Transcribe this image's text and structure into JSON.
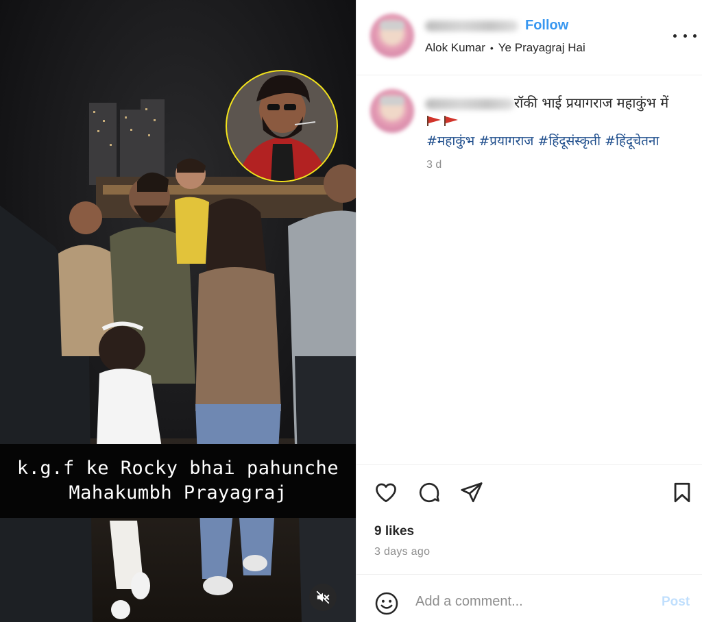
{
  "media": {
    "caption_lines": [
      "k.g.f ke Rocky bhai pahunche",
      "Mahakumbh Prayagraj"
    ],
    "mute_icon": "speaker-muted-icon"
  },
  "header": {
    "follow_label": "Follow",
    "audio_artist": "Alok Kumar",
    "audio_separator": "•",
    "audio_title": "Ye Prayagraj Hai",
    "more_icon": "more-horizontal-icon"
  },
  "caption": {
    "text": "रॉकी भाई प्रयागराज महाकुंभ में",
    "flags_icon": "red-flag-icon",
    "hashtags": [
      "#महाकुंभ",
      "#प्रयागराज",
      "#हिंदूसंस्कृती",
      "#हिंदूचेतना"
    ],
    "age": "3 d"
  },
  "actions": {
    "like_icon": "heart-icon",
    "comment_icon": "comment-icon",
    "share_icon": "send-icon",
    "save_icon": "bookmark-icon",
    "likes": "9 likes",
    "posted": "3 days ago"
  },
  "comment_box": {
    "emoji_icon": "emoji-icon",
    "placeholder": "Add a comment...",
    "post_label": "Post"
  },
  "colors": {
    "follow": "#3897f0",
    "hashtag": "#1f4e8c",
    "post_disabled": "#c0dffd",
    "flag": "#d1342b",
    "inset_ring": "#f5e51b"
  }
}
